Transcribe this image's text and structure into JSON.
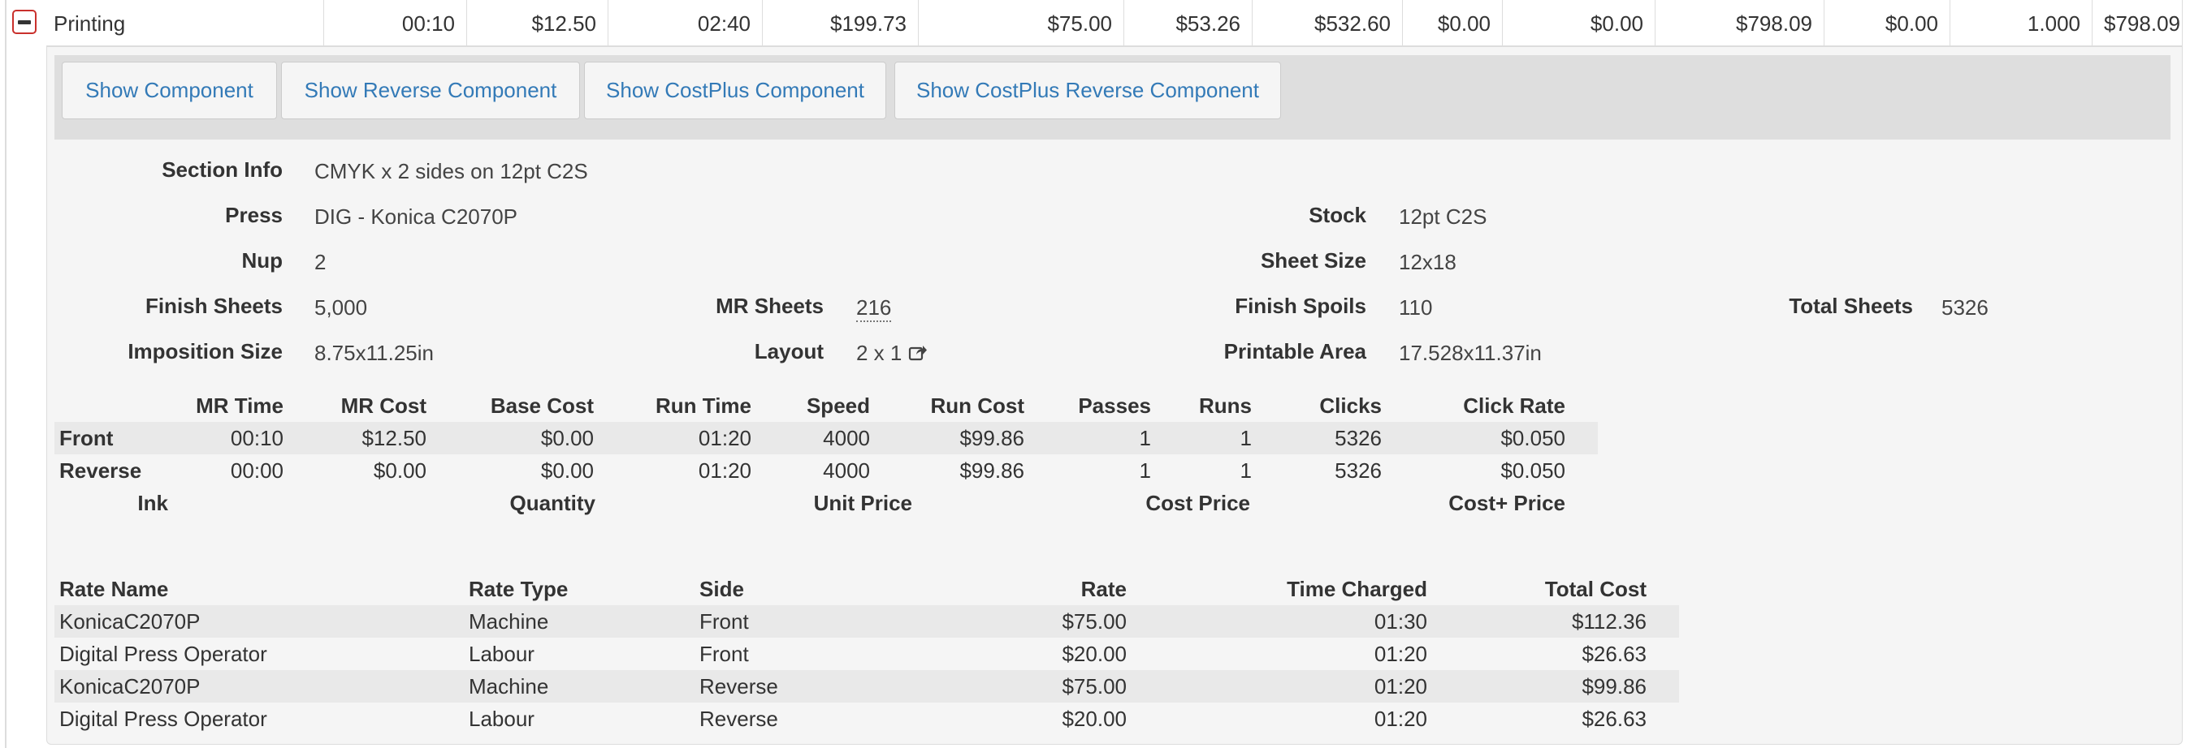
{
  "row": {
    "name": "Printing",
    "cells": [
      "00:10",
      "$12.50",
      "02:40",
      "$199.73",
      "$75.00",
      "$53.26",
      "$532.60",
      "$0.00",
      "$0.00",
      "$798.09",
      "$0.00",
      "1.000",
      "$798.09"
    ]
  },
  "buttons": {
    "show_component": "Show Component",
    "show_reverse_component": "Show Reverse Component",
    "show_costplus_component": "Show CostPlus Component",
    "show_costplus_reverse_component": "Show CostPlus Reverse Component"
  },
  "info": {
    "section_info": {
      "label": "Section Info",
      "value": "CMYK x 2 sides on 12pt C2S"
    },
    "press": {
      "label": "Press",
      "value": "DIG - Konica C2070P"
    },
    "stock": {
      "label": "Stock",
      "value": "12pt C2S"
    },
    "nup": {
      "label": "Nup",
      "value": "2"
    },
    "sheet_size": {
      "label": "Sheet Size",
      "value": "12x18"
    },
    "finish_sheets": {
      "label": "Finish Sheets",
      "value": "5,000"
    },
    "mr_sheets": {
      "label": "MR Sheets",
      "value": "216"
    },
    "finish_spoils": {
      "label": "Finish Spoils",
      "value": "110"
    },
    "total_sheets": {
      "label": "Total Sheets",
      "value": "5326"
    },
    "imposition_size": {
      "label": "Imposition Size",
      "value": "8.75x11.25in"
    },
    "layout": {
      "label": "Layout",
      "value": "2 x 1"
    },
    "printable_area": {
      "label": "Printable Area",
      "value": "17.528x11.37in"
    }
  },
  "cost_table": {
    "headers": [
      "MR Time",
      "MR Cost",
      "Base Cost",
      "Run Time",
      "Speed",
      "Run Cost",
      "Passes",
      "Runs",
      "Clicks",
      "Click Rate"
    ],
    "rows": [
      {
        "side": "Front",
        "values": [
          "00:10",
          "$12.50",
          "$0.00",
          "01:20",
          "4000",
          "$99.86",
          "1",
          "1",
          "5326",
          "$0.050"
        ]
      },
      {
        "side": "Reverse",
        "values": [
          "00:00",
          "$0.00",
          "$0.00",
          "01:20",
          "4000",
          "$99.86",
          "1",
          "1",
          "5326",
          "$0.050"
        ]
      }
    ]
  },
  "ink_table": {
    "headers": [
      "Ink",
      "Quantity",
      "Unit Price",
      "Cost Price",
      "Cost+ Price"
    ]
  },
  "rate_table": {
    "headers": [
      "Rate Name",
      "Rate Type",
      "Side",
      "Rate",
      "Time Charged",
      "Total Cost"
    ],
    "rows": [
      [
        "KonicaC2070P",
        "Machine",
        "Front",
        "$75.00",
        "01:30",
        "$112.36"
      ],
      [
        "Digital Press Operator",
        "Labour",
        "Front",
        "$20.00",
        "01:20",
        "$26.63"
      ],
      [
        "KonicaC2070P",
        "Machine",
        "Reverse",
        "$75.00",
        "01:20",
        "$99.86"
      ],
      [
        "Digital Press Operator",
        "Labour",
        "Reverse",
        "$20.00",
        "01:20",
        "$26.63"
      ]
    ]
  },
  "icons": {
    "collapse": "minus-square-icon",
    "layout_link": "share-square-icon"
  },
  "colors": {
    "accent": "#337ab7",
    "collapse_border": "#c9302c",
    "panel": "#f5f5f5",
    "toolbar": "#dedede"
  }
}
